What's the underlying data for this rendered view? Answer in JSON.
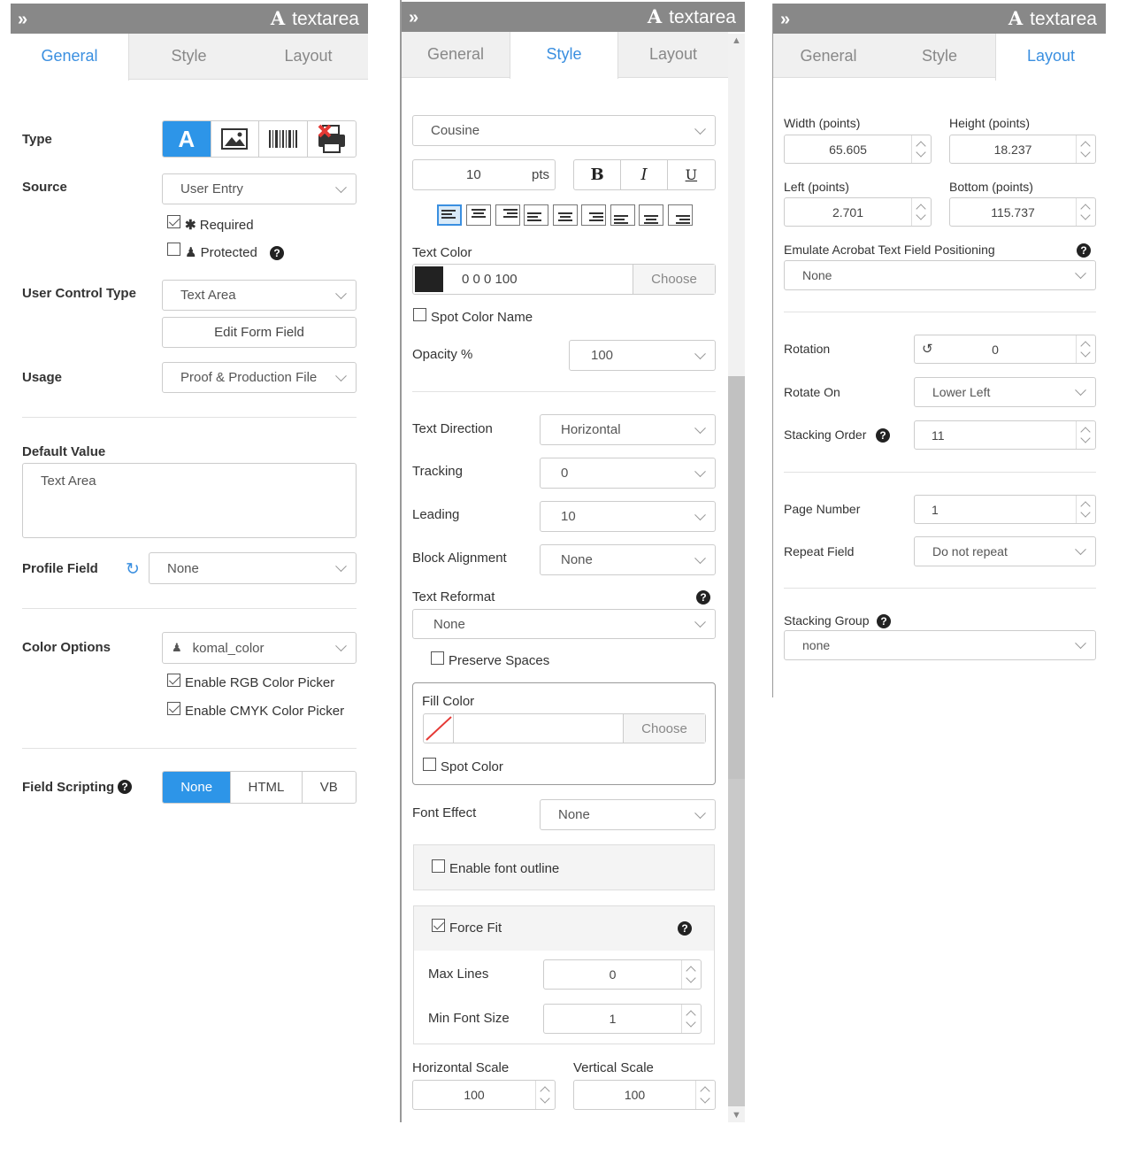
{
  "header": {
    "title": "textarea"
  },
  "tabs": {
    "general": "General",
    "style": "Style",
    "layout": "Layout"
  },
  "general": {
    "type_label": "Type",
    "source_label": "Source",
    "source_value": "User Entry",
    "required_label": "Required",
    "protected_label": "Protected",
    "user_control_type_label": "User Control Type",
    "user_control_type_value": "Text Area",
    "edit_form_field": "Edit Form Field",
    "usage_label": "Usage",
    "usage_value": "Proof & Production File",
    "default_value_label": "Default Value",
    "default_value_placeholder": "Text Area",
    "profile_field_label": "Profile Field",
    "profile_field_value": "None",
    "color_options_label": "Color Options",
    "color_options_value": "komal_color",
    "enable_rgb": "Enable RGB Color Picker",
    "enable_cmyk": "Enable CMYK Color Picker",
    "field_scripting_label": "Field Scripting",
    "scripting_options": [
      "None",
      "HTML",
      "VB"
    ]
  },
  "style": {
    "font": "Cousine",
    "font_size": "10",
    "font_unit": "pts",
    "bold": "B",
    "italic": "I",
    "underline": "U",
    "text_color_label": "Text Color",
    "text_color_value": "0 0 0 100",
    "choose": "Choose",
    "spot_color_name": "Spot Color Name",
    "opacity_label": "Opacity %",
    "opacity_value": "100",
    "text_direction_label": "Text Direction",
    "text_direction_value": "Horizontal",
    "tracking_label": "Tracking",
    "tracking_value": "0",
    "leading_label": "Leading",
    "leading_value": "10",
    "block_alignment_label": "Block Alignment",
    "block_alignment_value": "None",
    "text_reformat_label": "Text Reformat",
    "text_reformat_value": "None",
    "preserve_spaces": "Preserve Spaces",
    "fill_color_label": "Fill Color",
    "fill_choose": "Choose",
    "spot_color": "Spot Color",
    "font_effect_label": "Font Effect",
    "font_effect_value": "None",
    "enable_font_outline": "Enable font outline",
    "force_fit": "Force Fit",
    "max_lines_label": "Max Lines",
    "max_lines_value": "0",
    "min_font_size_label": "Min Font Size",
    "min_font_size_value": "1",
    "horizontal_scale_label": "Horizontal Scale",
    "horizontal_scale_value": "100",
    "vertical_scale_label": "Vertical Scale",
    "vertical_scale_value": "100"
  },
  "layout": {
    "width_label": "Width (points)",
    "width_value": "65.605",
    "height_label": "Height (points)",
    "height_value": "18.237",
    "left_label": "Left (points)",
    "left_value": "2.701",
    "bottom_label": "Bottom (points)",
    "bottom_value": "115.737",
    "emulate_label": "Emulate Acrobat Text Field Positioning",
    "emulate_value": "None",
    "rotation_label": "Rotation",
    "rotation_value": "0",
    "rotate_on_label": "Rotate On",
    "rotate_on_value": "Lower Left",
    "stacking_order_label": "Stacking Order",
    "stacking_order_value": "11",
    "page_number_label": "Page Number",
    "page_number_value": "1",
    "repeat_field_label": "Repeat Field",
    "repeat_field_value": "Do not repeat",
    "stacking_group_label": "Stacking Group",
    "stacking_group_value": "none"
  },
  "colors": {
    "accent": "#3a8fe0",
    "header": "#888888",
    "active_segment": "#2d95e8"
  }
}
